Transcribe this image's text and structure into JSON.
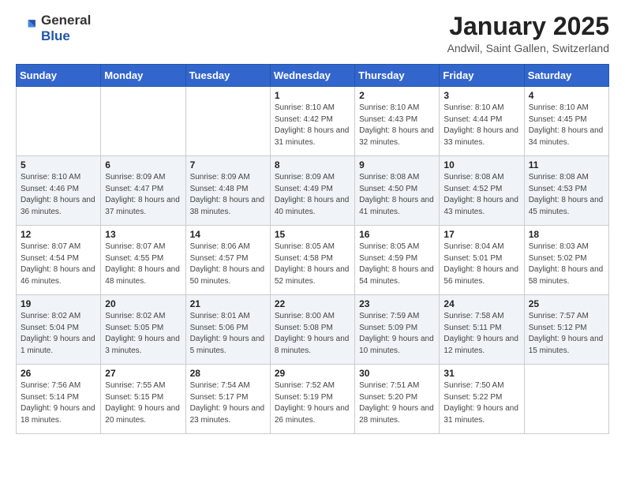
{
  "header": {
    "logo_general": "General",
    "logo_blue": "Blue",
    "month_title": "January 2025",
    "location": "Andwil, Saint Gallen, Switzerland"
  },
  "days_of_week": [
    "Sunday",
    "Monday",
    "Tuesday",
    "Wednesday",
    "Thursday",
    "Friday",
    "Saturday"
  ],
  "weeks": [
    [
      {
        "day": "",
        "info": ""
      },
      {
        "day": "",
        "info": ""
      },
      {
        "day": "",
        "info": ""
      },
      {
        "day": "1",
        "info": "Sunrise: 8:10 AM\nSunset: 4:42 PM\nDaylight: 8 hours and 31 minutes."
      },
      {
        "day": "2",
        "info": "Sunrise: 8:10 AM\nSunset: 4:43 PM\nDaylight: 8 hours and 32 minutes."
      },
      {
        "day": "3",
        "info": "Sunrise: 8:10 AM\nSunset: 4:44 PM\nDaylight: 8 hours and 33 minutes."
      },
      {
        "day": "4",
        "info": "Sunrise: 8:10 AM\nSunset: 4:45 PM\nDaylight: 8 hours and 34 minutes."
      }
    ],
    [
      {
        "day": "5",
        "info": "Sunrise: 8:10 AM\nSunset: 4:46 PM\nDaylight: 8 hours and 36 minutes."
      },
      {
        "day": "6",
        "info": "Sunrise: 8:09 AM\nSunset: 4:47 PM\nDaylight: 8 hours and 37 minutes."
      },
      {
        "day": "7",
        "info": "Sunrise: 8:09 AM\nSunset: 4:48 PM\nDaylight: 8 hours and 38 minutes."
      },
      {
        "day": "8",
        "info": "Sunrise: 8:09 AM\nSunset: 4:49 PM\nDaylight: 8 hours and 40 minutes."
      },
      {
        "day": "9",
        "info": "Sunrise: 8:08 AM\nSunset: 4:50 PM\nDaylight: 8 hours and 41 minutes."
      },
      {
        "day": "10",
        "info": "Sunrise: 8:08 AM\nSunset: 4:52 PM\nDaylight: 8 hours and 43 minutes."
      },
      {
        "day": "11",
        "info": "Sunrise: 8:08 AM\nSunset: 4:53 PM\nDaylight: 8 hours and 45 minutes."
      }
    ],
    [
      {
        "day": "12",
        "info": "Sunrise: 8:07 AM\nSunset: 4:54 PM\nDaylight: 8 hours and 46 minutes."
      },
      {
        "day": "13",
        "info": "Sunrise: 8:07 AM\nSunset: 4:55 PM\nDaylight: 8 hours and 48 minutes."
      },
      {
        "day": "14",
        "info": "Sunrise: 8:06 AM\nSunset: 4:57 PM\nDaylight: 8 hours and 50 minutes."
      },
      {
        "day": "15",
        "info": "Sunrise: 8:05 AM\nSunset: 4:58 PM\nDaylight: 8 hours and 52 minutes."
      },
      {
        "day": "16",
        "info": "Sunrise: 8:05 AM\nSunset: 4:59 PM\nDaylight: 8 hours and 54 minutes."
      },
      {
        "day": "17",
        "info": "Sunrise: 8:04 AM\nSunset: 5:01 PM\nDaylight: 8 hours and 56 minutes."
      },
      {
        "day": "18",
        "info": "Sunrise: 8:03 AM\nSunset: 5:02 PM\nDaylight: 8 hours and 58 minutes."
      }
    ],
    [
      {
        "day": "19",
        "info": "Sunrise: 8:02 AM\nSunset: 5:04 PM\nDaylight: 9 hours and 1 minute."
      },
      {
        "day": "20",
        "info": "Sunrise: 8:02 AM\nSunset: 5:05 PM\nDaylight: 9 hours and 3 minutes."
      },
      {
        "day": "21",
        "info": "Sunrise: 8:01 AM\nSunset: 5:06 PM\nDaylight: 9 hours and 5 minutes."
      },
      {
        "day": "22",
        "info": "Sunrise: 8:00 AM\nSunset: 5:08 PM\nDaylight: 9 hours and 8 minutes."
      },
      {
        "day": "23",
        "info": "Sunrise: 7:59 AM\nSunset: 5:09 PM\nDaylight: 9 hours and 10 minutes."
      },
      {
        "day": "24",
        "info": "Sunrise: 7:58 AM\nSunset: 5:11 PM\nDaylight: 9 hours and 12 minutes."
      },
      {
        "day": "25",
        "info": "Sunrise: 7:57 AM\nSunset: 5:12 PM\nDaylight: 9 hours and 15 minutes."
      }
    ],
    [
      {
        "day": "26",
        "info": "Sunrise: 7:56 AM\nSunset: 5:14 PM\nDaylight: 9 hours and 18 minutes."
      },
      {
        "day": "27",
        "info": "Sunrise: 7:55 AM\nSunset: 5:15 PM\nDaylight: 9 hours and 20 minutes."
      },
      {
        "day": "28",
        "info": "Sunrise: 7:54 AM\nSunset: 5:17 PM\nDaylight: 9 hours and 23 minutes."
      },
      {
        "day": "29",
        "info": "Sunrise: 7:52 AM\nSunset: 5:19 PM\nDaylight: 9 hours and 26 minutes."
      },
      {
        "day": "30",
        "info": "Sunrise: 7:51 AM\nSunset: 5:20 PM\nDaylight: 9 hours and 28 minutes."
      },
      {
        "day": "31",
        "info": "Sunrise: 7:50 AM\nSunset: 5:22 PM\nDaylight: 9 hours and 31 minutes."
      },
      {
        "day": "",
        "info": ""
      }
    ]
  ]
}
